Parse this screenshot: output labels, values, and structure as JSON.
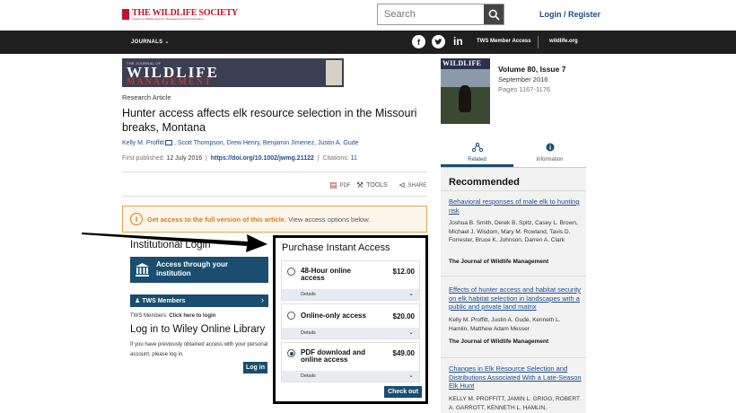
{
  "header": {
    "logo_text": "THE WILDLIFE SOCIETY",
    "logo_sub": "Leaders in Wildlife Science, Management and Conservation",
    "search_placeholder": "Search",
    "login_label": "Login / Register"
  },
  "nav": {
    "journals_label": "JOURNALS",
    "tws_access_label": "TWS Member Access",
    "wildlife_org_label": "wildlife.org",
    "facebook_glyph": "f",
    "linkedin_glyph": "in"
  },
  "banner": {
    "journal_of": "THE JOURNAL OF",
    "wildlife": "WILDLIFE",
    "management": "MANAGEMENT"
  },
  "article": {
    "type": "Research Article",
    "title": "Hunter access affects elk resource selection in the Missouri breaks, Montana",
    "authors": [
      "Kelly M. Proffitt",
      "Scott Thompson",
      "Drew Henry",
      "Benjamin Jimenez",
      "Justin A. Gude"
    ],
    "first_published_label": "First published:",
    "first_published": "12 July 2016",
    "doi": "https://doi.org/10.1002/jwmg.21122",
    "citations_label": "Citations:",
    "citations": "11",
    "sep": "|"
  },
  "tools": {
    "pdf": "PDF",
    "tools": "TOOLS",
    "share": "SHARE"
  },
  "alert": {
    "text": "Get access to the full version of this article.",
    "link": "View access options below."
  },
  "institutional": {
    "title": "Institutional Login",
    "access_button": "Access through your institution",
    "tws_members_button": "TWS Members",
    "tws_note_prefix": "TWS Members:",
    "tws_note_link": "Click here to login",
    "wiley_title": "Log in to Wiley Online Library",
    "wiley_note": "If you have previously obtained access with your personal account, please log in.",
    "login_button": "Log in"
  },
  "purchase": {
    "title": "Purchase Instant Access",
    "details_label": "Details",
    "options": [
      {
        "label": "48-Hour online access",
        "price": "$12.00",
        "selected": false
      },
      {
        "label": "Online-only access",
        "price": "$20.00",
        "selected": false
      },
      {
        "label": "PDF download and online access",
        "price": "$49.00",
        "selected": true
      }
    ],
    "checkout_button": "Check out"
  },
  "issue": {
    "cover_title": "WILDLIFE",
    "volume": "Volume 80, Issue 7",
    "date": "September 2016",
    "pages": "Pages 1167-1176"
  },
  "tabs": {
    "related": "Related",
    "information": "Information"
  },
  "recommended": {
    "title": "Recommended",
    "items": [
      {
        "title": "Behavioral responses of male elk to hunting risk",
        "authors": "Joshua B. Smith, Derek B. Spitz, Casey L. Brown, Michael J. Wisdom, Mary M. Rowland, Tavis D. Forrester, Bruce K. Johnson, Darren A. Clark",
        "journal": "The Journal of Wildlife Management"
      },
      {
        "title": "Effects of hunter access and habitat security on elk habitat selection in landscapes with a public and private land matrix",
        "authors": "Kelly M. Proffitt, Justin A. Gude, Kenneth L. Hamlin, Matthew Adam Messer",
        "journal": "The Journal of Wildlife Management"
      },
      {
        "title": "Changes in Elk Resource Selection and Distributions Associated With a Late-Season Elk Hunt",
        "authors": "KELLY M. PROFFITT, JAMIN L. GRIGG, ROBERT A. GARROTT, KENNETH L. HAMLIN,",
        "journal": ""
      }
    ]
  }
}
